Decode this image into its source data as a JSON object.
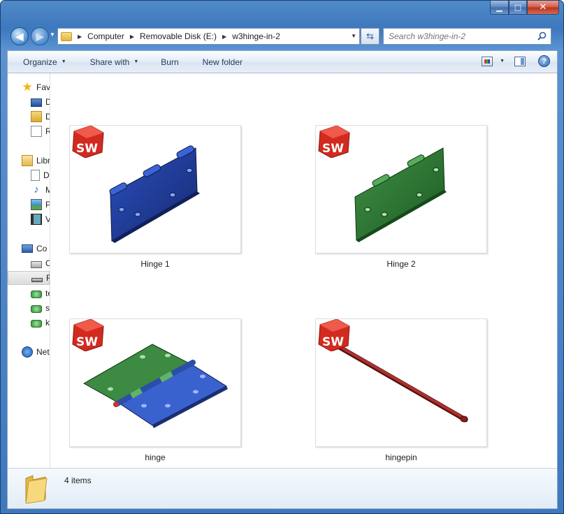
{
  "window": {
    "caption_buttons": {
      "minimize": "▁",
      "maximize": "□",
      "close": "✕"
    }
  },
  "address_bar": {
    "crumbs": [
      "Computer",
      "Removable Disk (E:)",
      "w3hinge-in-2"
    ]
  },
  "search": {
    "placeholder": "Search w3hinge-in-2"
  },
  "toolbar": {
    "organize": "Organize",
    "share_with": "Share with",
    "burn": "Burn",
    "new_folder": "New folder",
    "help": "?"
  },
  "nav_pane": {
    "favorites": "Fav",
    "fav_desktop": "D",
    "fav_downloads": "D",
    "fav_recent": "R",
    "libraries": "Libr",
    "lib_documents": "D",
    "lib_music": "M",
    "lib_pictures": "P",
    "lib_videos": "V",
    "computer": "Co",
    "local_disk": "C",
    "removable_disk": "R",
    "net_drive_1": "te",
    "net_drive_2": "sy",
    "net_drive_3": "k",
    "network": "Net"
  },
  "items": [
    {
      "label": "Hinge 1",
      "model_color": "#1f3fa6",
      "badge": "SW"
    },
    {
      "label": "Hinge 2",
      "model_color": "#2f7a35",
      "badge": "SW"
    },
    {
      "label": "hinge",
      "model_color": "#3a62cf",
      "badge": "SW"
    },
    {
      "label": "hingepin",
      "model_color": "#8a1e1e",
      "badge": "SW"
    }
  ],
  "status": {
    "item_count": "4 items"
  }
}
